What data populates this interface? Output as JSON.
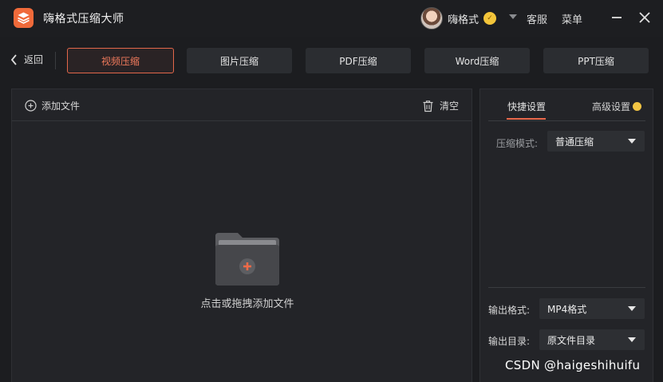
{
  "app": {
    "title": "嗨格式压缩大师",
    "brand_color": "#f06a3a"
  },
  "user": {
    "name": "嗨格式"
  },
  "titlebar": {
    "service_label": "客服",
    "menu_label": "菜单"
  },
  "nav": {
    "back_label": "返回",
    "tabs": [
      {
        "label": "视频压缩",
        "active": true
      },
      {
        "label": "图片压缩",
        "active": false
      },
      {
        "label": "PDF压缩",
        "active": false
      },
      {
        "label": "Word压缩",
        "active": false
      },
      {
        "label": "PPT压缩",
        "active": false
      }
    ]
  },
  "file_panel": {
    "add_file_label": "添加文件",
    "clear_label": "清空",
    "drop_hint": "点击或拖拽添加文件"
  },
  "settings": {
    "tabs": [
      {
        "label": "快捷设置",
        "active": true
      },
      {
        "label": "高级设置",
        "active": false
      }
    ],
    "compression_mode": {
      "label": "压缩模式:",
      "value": "普通压缩"
    },
    "output_format": {
      "label": "输出格式:",
      "value": "MP4格式"
    },
    "output_dir": {
      "label": "输出目录:",
      "value": "原文件目录"
    }
  },
  "watermark": "CSDN @haigeshihuifu",
  "icons": {
    "logo": "app-logo-icon",
    "vip": "vip-badge-icon",
    "minimize": "minimize-icon",
    "close": "close-icon",
    "back": "chevron-left-icon",
    "add": "plus-circle-icon",
    "trash": "trash-icon",
    "folder": "folder-add-icon"
  },
  "colors": {
    "accent": "#e8674a",
    "background": "#1c1d20",
    "panel": "#232428"
  }
}
